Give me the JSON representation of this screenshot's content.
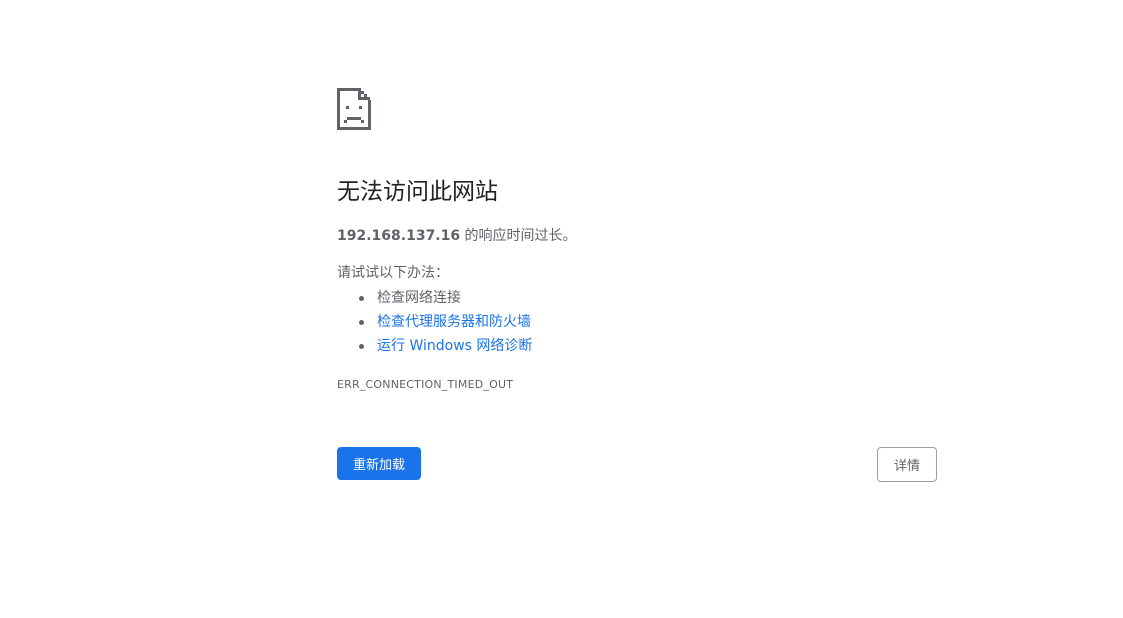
{
  "icon": {
    "name": "sad-page-icon",
    "color": "#5f6368"
  },
  "title": "无法访问此网站",
  "summary": {
    "host": "192.168.137.16",
    "message": " 的响应时间过长。"
  },
  "suggestions": {
    "heading": "请试试以下办法：",
    "items": [
      {
        "label": "检查网络连接",
        "is_link": false
      },
      {
        "label": "检查代理服务器和防火墙",
        "is_link": true
      },
      {
        "label": "运行 Windows 网络诊断",
        "is_link": true
      }
    ]
  },
  "error_code": "ERR_CONNECTION_TIMED_OUT",
  "buttons": {
    "reload_label": "重新加载",
    "details_label": "详情"
  },
  "colors": {
    "primary": "#1a73e8",
    "text_secondary": "#5f6368",
    "text_primary": "#202124"
  }
}
